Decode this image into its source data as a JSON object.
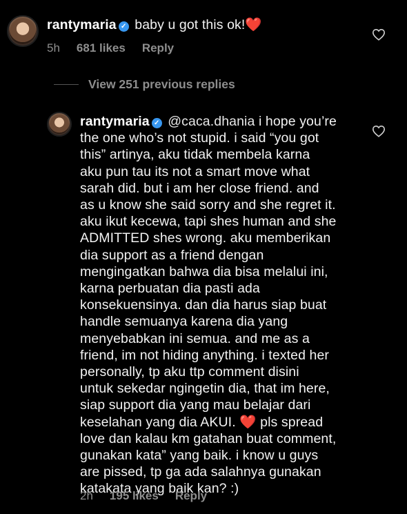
{
  "comment1": {
    "username": "rantymaria",
    "text": "baby u got this ok!",
    "emoji": "❤️",
    "time": "5h",
    "likes": "681 likes",
    "reply": "Reply"
  },
  "view_replies": "View 251 previous replies",
  "comment2": {
    "username": "rantymaria",
    "mention": "@caca.dhania",
    "lines": [
      "i hope you’re",
      "the one who’s not stupid. i said “you got",
      "this” artinya, aku tidak membela karna",
      "aku pun tau its not a smart move what",
      "sarah did. but i am her close friend. and",
      "as u know she said sorry and she regret it.",
      "aku ikut kecewa, tapi shes human and she",
      "ADMITTED shes wrong. aku memberikan",
      "dia support as a friend dengan",
      "mengingatkan bahwa dia bisa melalui ini,",
      "karna perbuatan dia pasti ada",
      "konsekuensinya. dan dia harus siap buat",
      "handle semuanya karena dia yang",
      "menyebabkan ini semua. and me as a",
      "friend, im not hiding anything. i texted her",
      "personally, tp aku ttp comment disini",
      "untuk sekedar ngingetin dia, that im here,",
      "siap support dia yang mau belajar dari",
      "keselahan yang dia AKUI.",
      "love dan kalau km gatahan buat comment,",
      "gunakan kata” yang baik. i know u guys",
      "are pissed, tp ga ada salahnya gunakan",
      "katakata yang baik kan? :)"
    ],
    "line19_tail": "pls spread",
    "emoji": "❤️",
    "time": "2h",
    "likes": "195 likes",
    "reply": "Reply"
  },
  "icons": {
    "verified": "verified-badge-icon",
    "like": "heart-outline-icon"
  },
  "colors": {
    "background": "#000000",
    "text": "#f2f2f2",
    "meta": "#8e8e8e",
    "verified": "#3897f0",
    "heart": "#ed2244"
  }
}
